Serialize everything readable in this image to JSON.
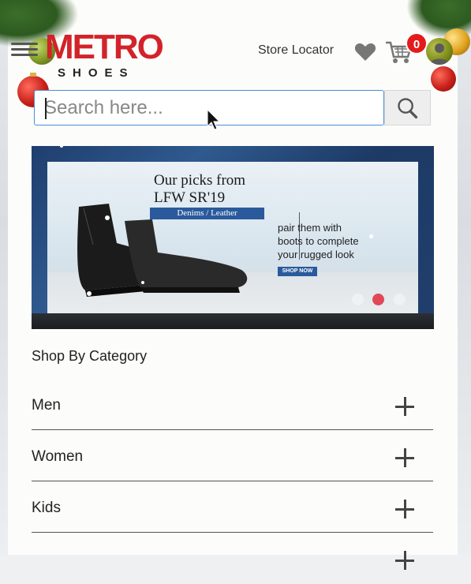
{
  "header": {
    "logo_main": "METRO",
    "logo_sub": "SHOES",
    "store_locator": "Store Locator",
    "cart_count": "0"
  },
  "search": {
    "placeholder": "Search here..."
  },
  "banner": {
    "title_line1": "Our picks from",
    "title_line2": "LFW SR'19",
    "strip": "Denims / Leather",
    "copy_line1": "pair them with",
    "copy_line2": "boots to complete",
    "copy_line3": "your rugged look",
    "cta": "SHOP NOW",
    "active_slide": 2
  },
  "category": {
    "heading": "Shop By Category",
    "items": [
      {
        "label": "Men"
      },
      {
        "label": "Women"
      },
      {
        "label": "Kids"
      },
      {
        "label": ""
      }
    ]
  },
  "colors": {
    "brand_red": "#d2232a",
    "search_border": "#4a8fd6",
    "badge_red": "#e41b1b",
    "slider_active": "#e04858"
  }
}
